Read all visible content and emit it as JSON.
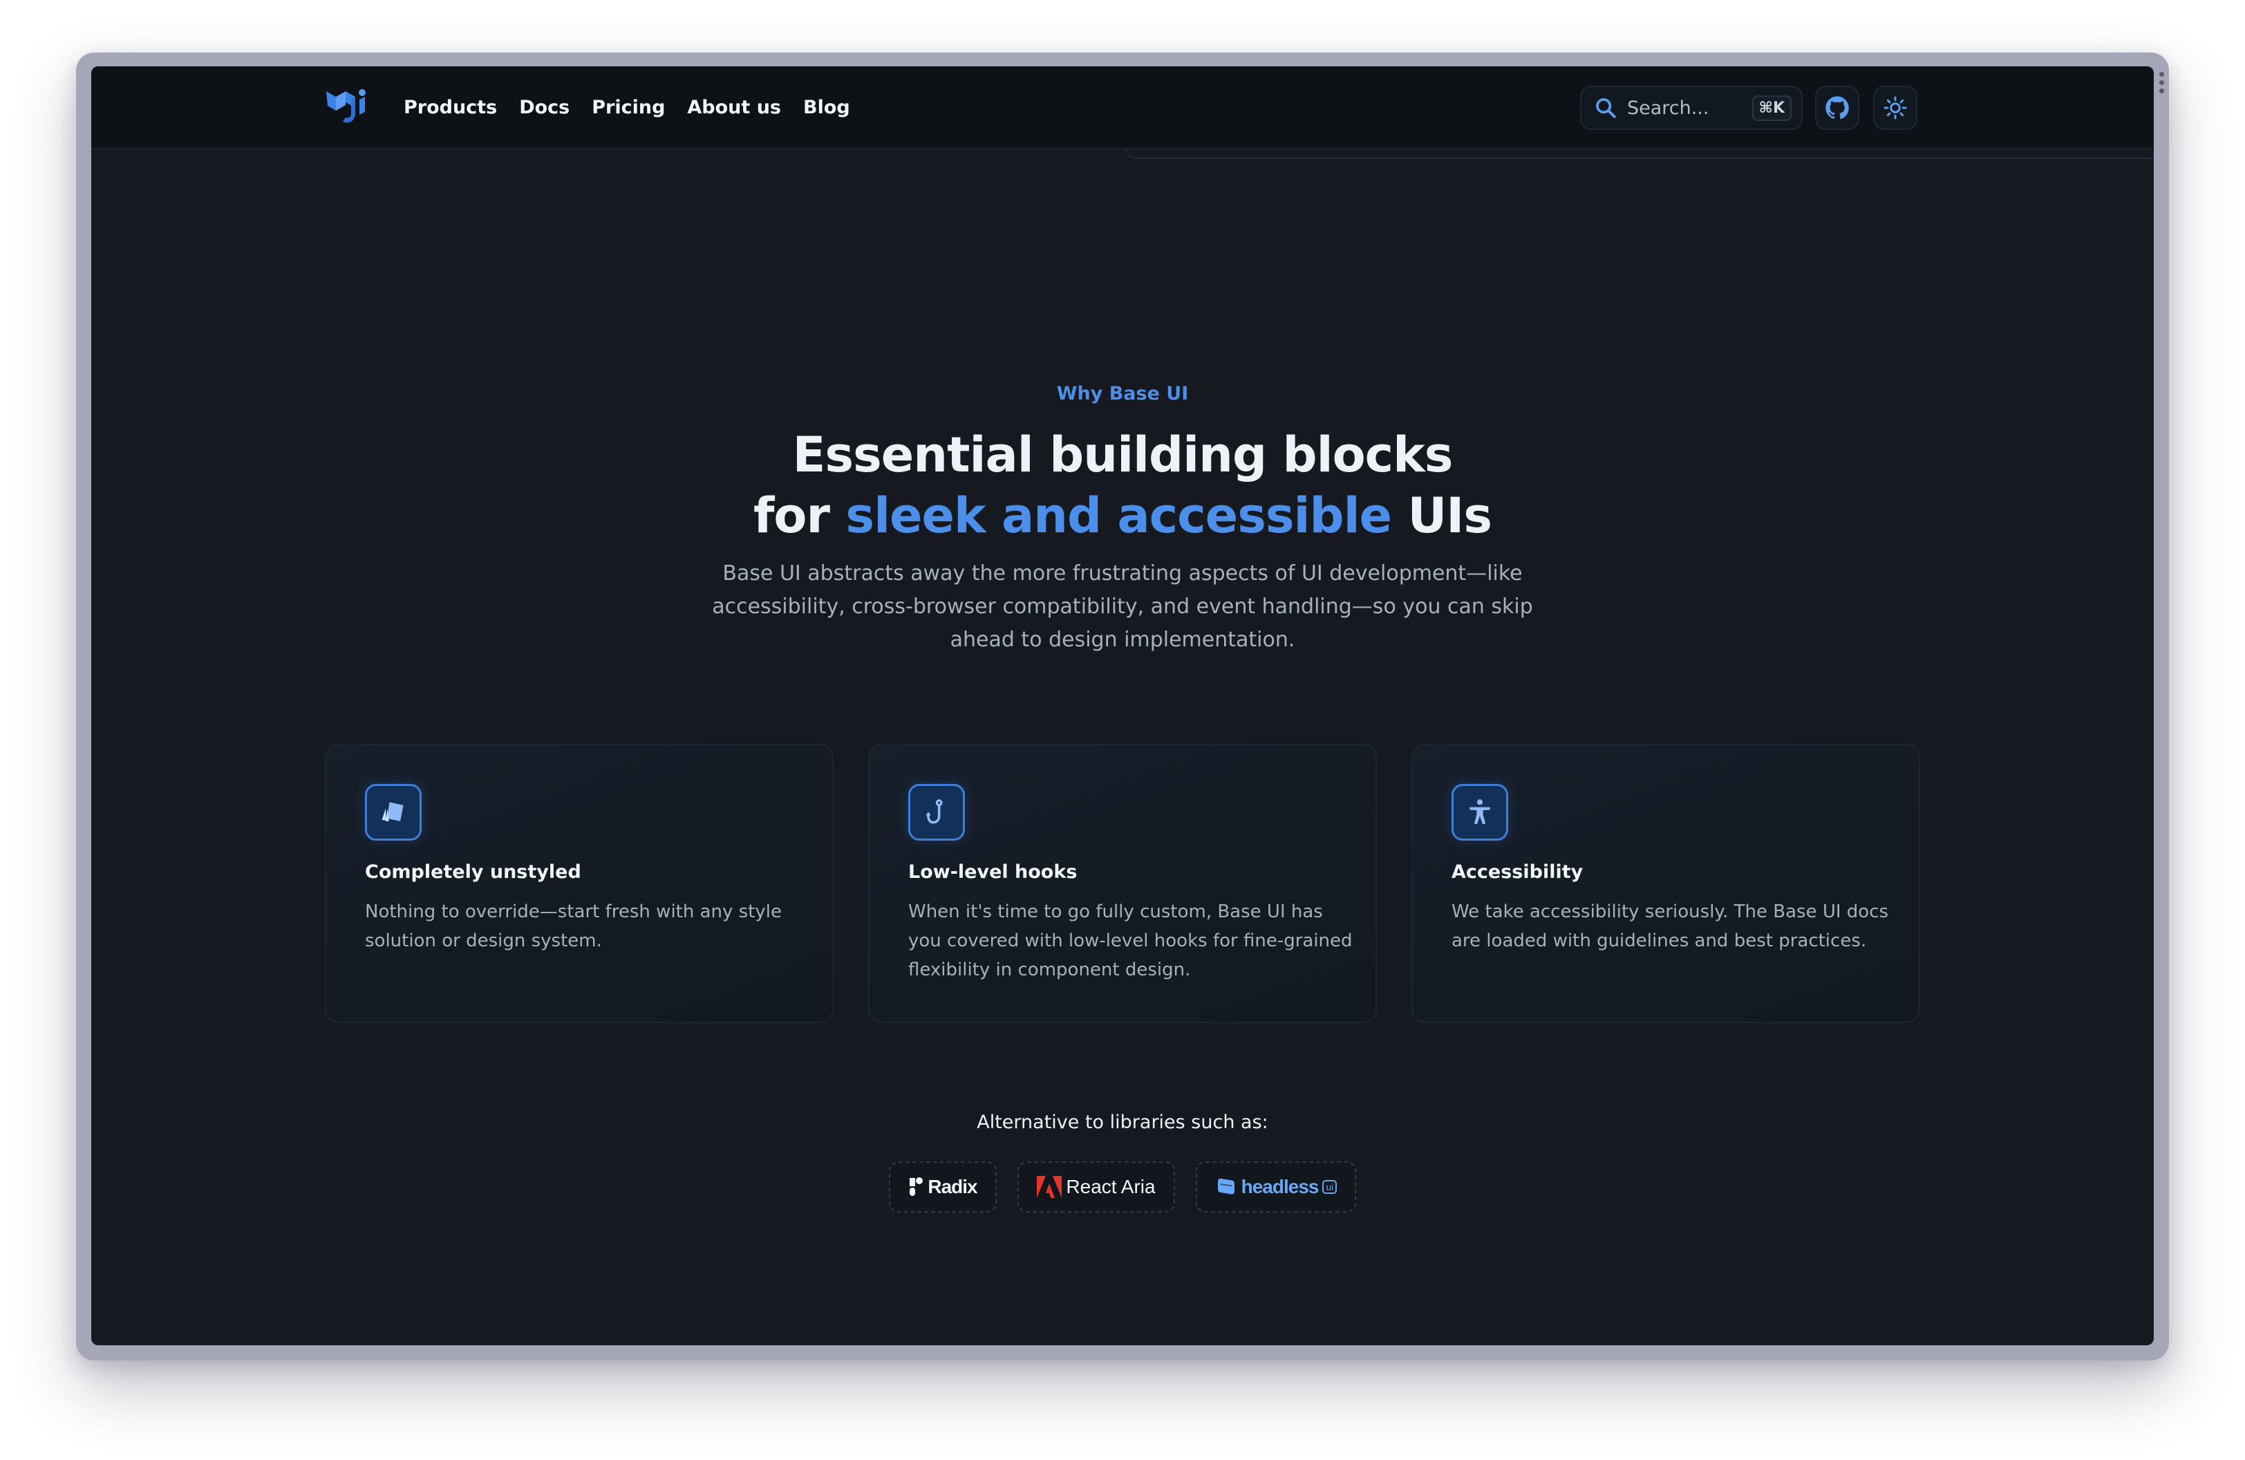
{
  "header": {
    "logo_name": "mui-logo",
    "nav": [
      "Products",
      "Docs",
      "Pricing",
      "About us",
      "Blog"
    ],
    "search": {
      "placeholder": "Search...",
      "shortcut": "⌘K"
    },
    "github_icon": "github-icon",
    "theme_icon": "sun-icon"
  },
  "hero": {
    "eyebrow": "Why Base UI",
    "headline_line1": "Essential building blocks",
    "headline_line2_pre": "for ",
    "headline_line2_accent": "sleek and accessible",
    "headline_line2_post": " UIs",
    "subtext_lines": [
      "Base UI abstracts away the more frustrating aspects of UI development—like",
      "accessibility, cross-browser compatibility, and event handling—so you can skip",
      "ahead to design implementation."
    ]
  },
  "features": [
    {
      "icon": "shapes-icon",
      "title": "Completely unstyled",
      "desc_lines": [
        "Nothing to override—start fresh with any style",
        "solution or design system."
      ]
    },
    {
      "icon": "hook-icon",
      "title": "Low-level hooks",
      "desc_lines": [
        "When it's time to go fully custom, Base UI has",
        "you covered with low-level hooks for fine-grained",
        "flexibility in component design."
      ]
    },
    {
      "icon": "accessibility-icon",
      "title": "Accessibility",
      "desc_lines": [
        "We take accessibility seriously. The Base UI docs",
        "are loaded with guidelines and best practices."
      ]
    }
  ],
  "alternatives": {
    "label": "Alternative to libraries such as:",
    "libraries": [
      {
        "name": "Radix",
        "icon": "radix-logo-icon"
      },
      {
        "name": "React Aria",
        "icon": "adobe-logo-icon"
      },
      {
        "name": "headless",
        "icon": "headless-ui-logo-icon",
        "badge": "ui"
      }
    ]
  },
  "colors": {
    "accent": "#4c8fea",
    "background": "#161a20",
    "header": "#0e1217",
    "frame": "#a5a6b8"
  }
}
